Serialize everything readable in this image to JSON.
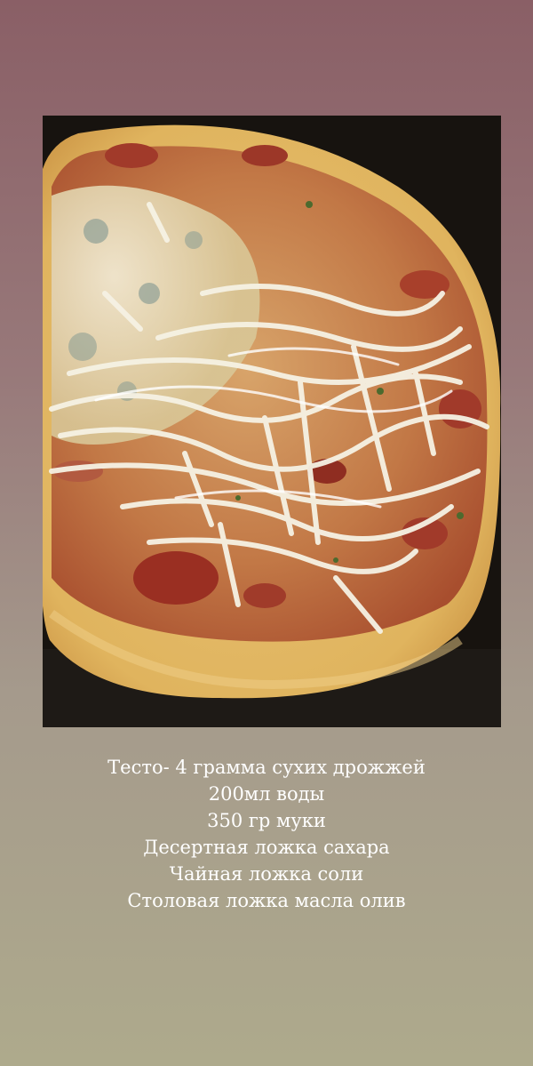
{
  "photo": {
    "subject": "pizza-photo"
  },
  "caption": {
    "lines": [
      "Тесто- 4 грамма сухих дрожжей",
      "200мл воды",
      "350 гр муки",
      "Десертная ложка сахара",
      "Чайная ложка соли",
      "Столовая ложка масла олив"
    ]
  },
  "colors": {
    "background_top": "#8a5f66",
    "background_bottom": "#aeaa8c",
    "caption_text": "#ffffff"
  }
}
